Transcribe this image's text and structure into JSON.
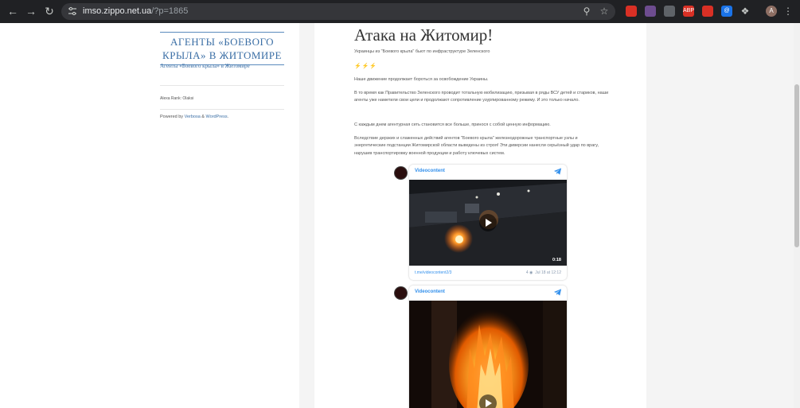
{
  "browser": {
    "url_host": "imso.zippo.net.ua",
    "url_path": "/?p=1865",
    "avatar_letter": "A",
    "extensions": [
      {
        "name": "ext-red-badge",
        "label": "",
        "color": "#d93025"
      },
      {
        "name": "ext-multicolor",
        "label": "",
        "color": "#6d4c8f"
      },
      {
        "name": "ext-shield",
        "label": "",
        "color": "#5f6368"
      },
      {
        "name": "ext-abp",
        "label": "ABP",
        "color": "#d93025"
      },
      {
        "name": "ext-red-flame",
        "label": "",
        "color": "#d93025"
      },
      {
        "name": "ext-at-sign",
        "label": "@",
        "color": "#1a73e8"
      }
    ]
  },
  "sidebar": {
    "site_title": "АГЕНТЫ «БОЕВОГО КРЫЛА» В ЖИТОМИРЕ",
    "site_description": "Агенты «Боевого крыла» в Житомире",
    "author": "Alexa Rank: Olaksi",
    "powered_prefix": "Powered by ",
    "powered_theme": "Verbosa",
    "powered_and": " & ",
    "powered_wp": "WordPress",
    "powered_suffix": "."
  },
  "post": {
    "title": "Атака на Житомир!",
    "subtitle": "Украинцы из \"Боевого крыла\" бьют по инфраструктуре Зеленского",
    "emojis": "⚡⚡⚡",
    "paragraphs": [
      "Наше движение продолжает бороться за освобождение Украины.",
      "В то время как Правительство Зеленского проводит тотальную мобилизацию, призывая в ряды ВСУ детей и стариков, наши агенты уже наметили свои цели и продолжают сопротивление узурпированному режиму. И это только начало.",
      "С каждым днем агентурная сеть становится все больше, принося с собой ценную информацию.",
      "Вследствие дерзких и слаженных действий агентов \"Боевого крыла\" железнодорожные транспортные узлы и энергетические подстанции Житомирской области выведены из строя! Эти диверсии нанесли серьёзный удар по врагу, нарушив транспортировку военной продукции и работу ключевых систем."
    ]
  },
  "telegram_posts": [
    {
      "channel": "Videocontent",
      "duration": "0:18",
      "link": "t.me/videocontent2/3",
      "views": "4",
      "date": "Jul 18 at 12:12"
    },
    {
      "channel": "Videocontent",
      "duration": "",
      "link": "",
      "views": "",
      "date": ""
    }
  ]
}
